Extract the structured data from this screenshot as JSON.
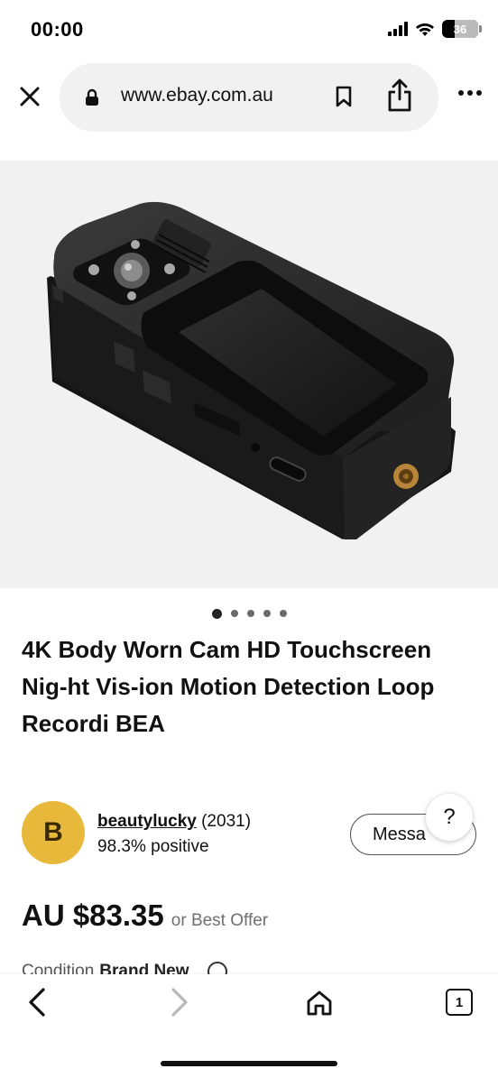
{
  "status_bar": {
    "time": "00:00",
    "battery": "36",
    "battery_level": 0.36,
    "icons": [
      "cellular-signal-icon",
      "wifi-icon",
      "battery-icon"
    ]
  },
  "browser": {
    "url": "www.ebay.com.au",
    "icons": [
      "close-icon",
      "lock-icon",
      "bookmark-icon",
      "share-icon",
      "more-icon"
    ]
  },
  "product": {
    "image_count": 5,
    "active_image": 1,
    "title": "4K Body Worn Cam HD Touchscreen Nig-ht Vis-ion Motion Detection Loop Recordi BEA"
  },
  "seller": {
    "initial": "B",
    "name": "beautylucky",
    "feedback_count": "(2031)",
    "positive": "98.3% positive",
    "message_label": "Messa"
  },
  "help": {
    "label": "?"
  },
  "price": {
    "amount": "AU $83.35",
    "offer": "or Best Offer"
  },
  "condition": {
    "label": "Condition",
    "value": "Brand New"
  },
  "toolbar": {
    "tab_count": "1",
    "icons": [
      "back-icon",
      "forward-icon",
      "home-icon",
      "tabs-icon"
    ]
  },
  "colors": {
    "avatar": "#e8b83a",
    "image_background": "#f1f1f1",
    "url_pill": "#f1f1f1"
  }
}
